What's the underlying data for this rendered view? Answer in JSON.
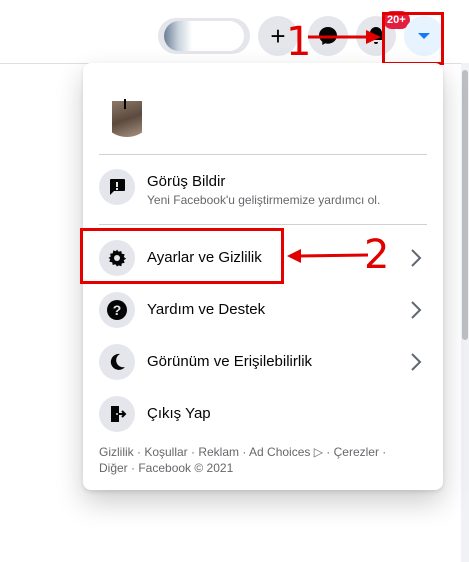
{
  "header": {
    "notification_badge": "20+",
    "create_icon": "plus-icon",
    "messenger_icon": "messenger-icon",
    "notifications_icon": "bell-icon",
    "account_icon": "caret-down-icon",
    "accent_color": "#1877f2"
  },
  "annotations": {
    "step1": "1",
    "step2": "2",
    "color": "#e00000"
  },
  "menu": {
    "items": [
      {
        "label": "Görüş Bildir",
        "sub": "Yeni Facebook'u geliştirmemize yardımcı ol.",
        "icon": "feedback-icon"
      },
      {
        "label": "Ayarlar ve Gizlilik",
        "icon": "gear-icon",
        "has_submenu": true
      },
      {
        "label": "Yardım ve Destek",
        "icon": "help-icon",
        "has_submenu": true
      },
      {
        "label": "Görünüm ve Erişilebilirlik",
        "icon": "moon-icon",
        "has_submenu": true
      },
      {
        "label": "Çıkış Yap",
        "icon": "logout-icon"
      }
    ],
    "footer_line1": "Gizlilik · Koşullar · Reklam · Ad Choices ▷ · Çerezler ·",
    "footer_line2": "Diğer · Facebook © 2021"
  }
}
